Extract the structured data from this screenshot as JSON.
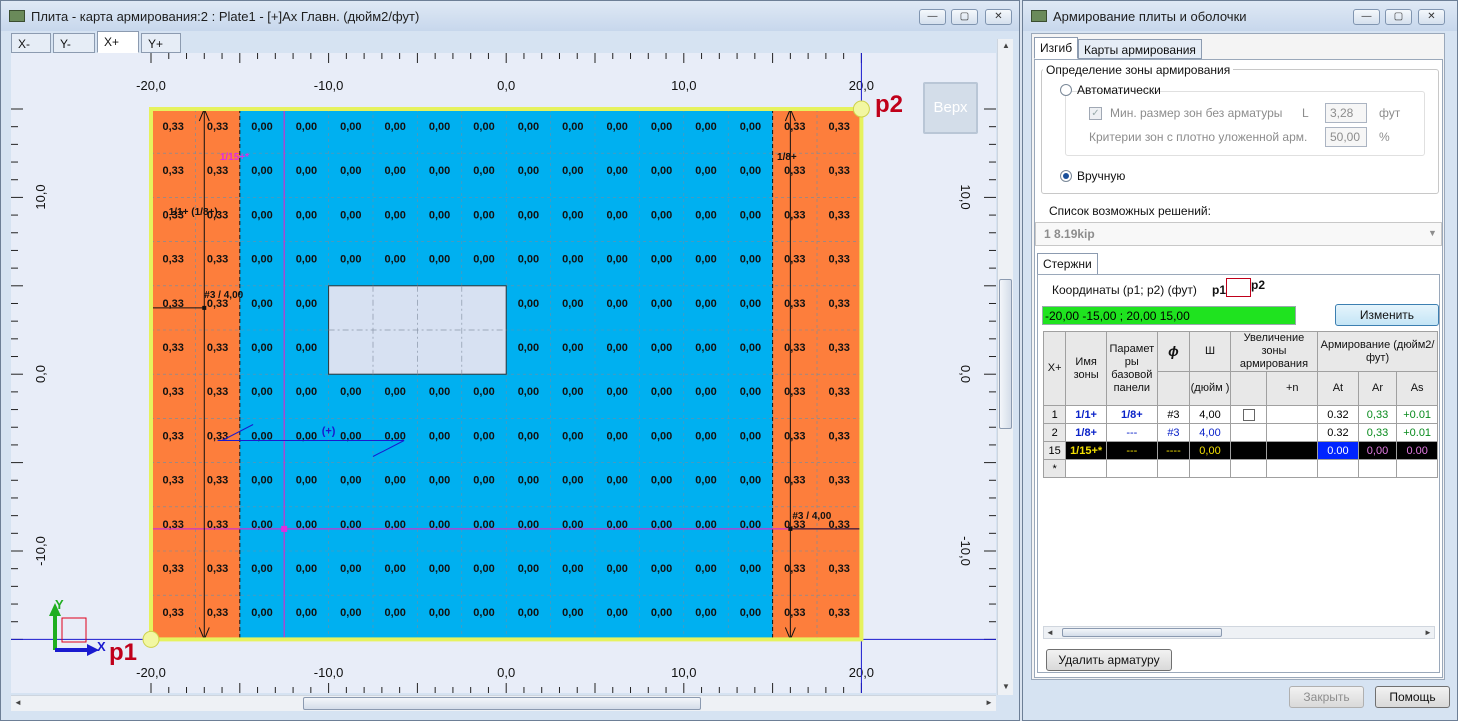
{
  "left_window": {
    "title": "Плита - карта армирования:2 : Plate1 - [+]Ах Главн. (дюйм2/фут)",
    "min_btn": "—",
    "max_btn": "▢",
    "close_btn": "✕",
    "tabs": [
      {
        "label": "X-"
      },
      {
        "label": "Y-"
      },
      {
        "label": "X+"
      },
      {
        "label": "Y+"
      }
    ],
    "active_tab": 2,
    "view_label": "Верх",
    "x_axis_ticks": [
      "-20,0",
      "-10,0",
      "0,0",
      "10,0",
      "20,0"
    ],
    "y_axis_ticks": [
      "10,0",
      "0,0",
      "-10,0"
    ],
    "p1_label": "p1",
    "p2_label": "p2",
    "axis_y_label": "Y",
    "axis_x_label": "X",
    "scroll_up": "▲",
    "scroll_down": "▼",
    "scroll_left": "◄",
    "scroll_right": "►",
    "grid": {
      "rows": 12,
      "cols": 16,
      "orange_cols": [
        0,
        1,
        14,
        15
      ],
      "orange_value": "0,33",
      "blue_value": "0,00",
      "opening": {
        "col_start": 4,
        "col_end": 7,
        "row_start": 4,
        "row_end": 5
      }
    },
    "annotations": {
      "zone_1_15": "1/15+*",
      "zone_1_8": "1/8+",
      "zone_1_1": "1/1+ (1/8+)",
      "bar_left": "#3 / 4,00",
      "bar_right": "#3 / 4,00",
      "plus_mark": "(+)"
    },
    "colors": {
      "orange": "#fd7e3c",
      "blue": "#00b0f0",
      "outline": "#e6f25e",
      "canvas_bg": "#e8edf8"
    }
  },
  "right_window": {
    "title": "Армирование плиты и оболочки",
    "min_btn": "—",
    "max_btn": "▢",
    "close_btn": "✕",
    "tabs": [
      {
        "label": "Изгиб"
      },
      {
        "label": "Карты армирования"
      }
    ],
    "zone_group_label": "Определение зоны армирования",
    "auto_radio": "Автоматически",
    "min_size_label": "Мин. размер зон без арматуры",
    "L_label": "L",
    "min_size_value": "3,28",
    "min_size_unit": "фут",
    "criteria_label": "Критерии зон с плотно уложенной арм.",
    "criteria_value": "50,00",
    "criteria_unit": "%",
    "manual_radio": "Вручную",
    "solutions_label": "Список возможных решений:",
    "solutions_value": "1   8.19kip",
    "bars_tab": "Стержни",
    "coords_label": "Координаты (p1; p2) (фут)",
    "coords_p1": "p1",
    "coords_p2": "p2",
    "coords_value": "-20,00 -15,00 ; 20,00 15,00",
    "change_button": "Изменить",
    "table": {
      "corner": "X+",
      "h_name": "Имя зоны",
      "h_params": "Парамет ры базовой панели",
      "h_phi": "ϕ",
      "h_sh": "Ш",
      "h_sh_unit": "(дюйм )",
      "h_enlarge": "Увеличение зоны армирования",
      "h_plus_n": "+n",
      "h_reinf": "Армирование (дюйм2/фут)",
      "h_at": "At",
      "h_ar": "Ar",
      "h_as": "As",
      "rows": [
        {
          "num": "1",
          "name": "1/1+",
          "params": "1/8+",
          "phi": "#3",
          "sh": "4,00",
          "at": "0.32",
          "ar": "0,33",
          "as": "+0.01"
        },
        {
          "num": "2",
          "name": "1/8+",
          "params": "---",
          "phi": "#3",
          "sh": "4,00",
          "at": "0.32",
          "ar": "0,33",
          "as": "+0.01"
        },
        {
          "num": "15",
          "name": "1/15+*",
          "params": "---",
          "phi": "----",
          "sh": "0,00",
          "at": "0.00",
          "ar": "0,00",
          "as": "0.00"
        }
      ],
      "new_row": "*"
    },
    "delete_button": "Удалить арматуру",
    "close_button": "Закрыть",
    "help_button": "Помощь"
  }
}
